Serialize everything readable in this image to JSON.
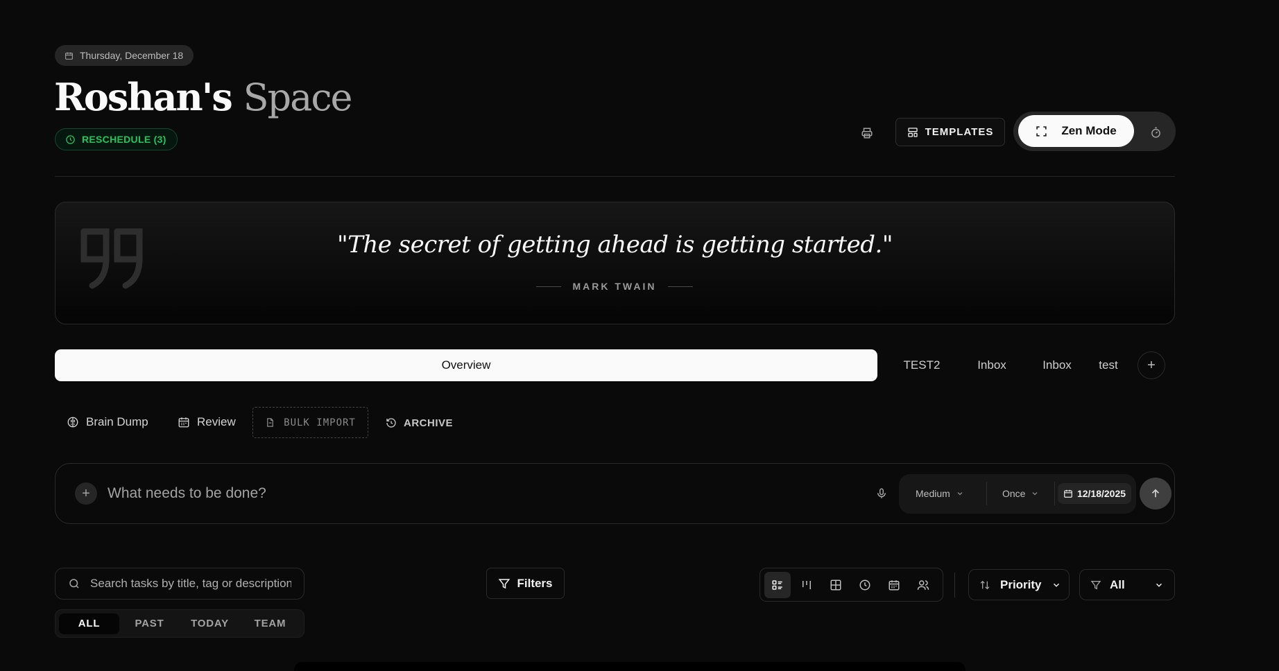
{
  "header": {
    "date": "Thursday, December 18",
    "title_bold": "Roshan's",
    "title_light": "Space",
    "reschedule_label": "RESCHEDULE (3)",
    "templates_label": "TEMPLATES",
    "zen_label": "Zen Mode"
  },
  "quote": {
    "text": "\"The secret of getting ahead is getting started.\"",
    "author": "MARK TWAIN"
  },
  "tabs": [
    {
      "label": "Overview",
      "active": true
    },
    {
      "label": "TEST2",
      "active": false
    },
    {
      "label": "Inbox",
      "active": false
    },
    {
      "label": "Inbox",
      "active": false
    },
    {
      "label": "test",
      "active": false
    }
  ],
  "actions": {
    "brain_dump": "Brain Dump",
    "review": "Review",
    "bulk_import": "BULK IMPORT",
    "archive": "ARCHIVE"
  },
  "task_input": {
    "placeholder": "What needs to be done?",
    "priority": "Medium",
    "recurrence": "Once",
    "date": "12/18/2025"
  },
  "search": {
    "placeholder": "Search tasks by title, tag or description",
    "filters_label": "Filters"
  },
  "views": [
    "list-view",
    "kanban-view",
    "grid-view",
    "timeline-view",
    "calendar-view",
    "team-view"
  ],
  "sort": {
    "label": "Priority"
  },
  "filter_scope": {
    "label": "All"
  },
  "segments": [
    {
      "label": "ALL",
      "active": true
    },
    {
      "label": "PAST",
      "active": false
    },
    {
      "label": "TODAY",
      "active": false
    },
    {
      "label": "TEAM",
      "active": false
    }
  ],
  "colors": {
    "background": "#0a0a0a",
    "accent_green": "#22c55e",
    "surface": "#171717",
    "primary_text": "#fafafa"
  }
}
